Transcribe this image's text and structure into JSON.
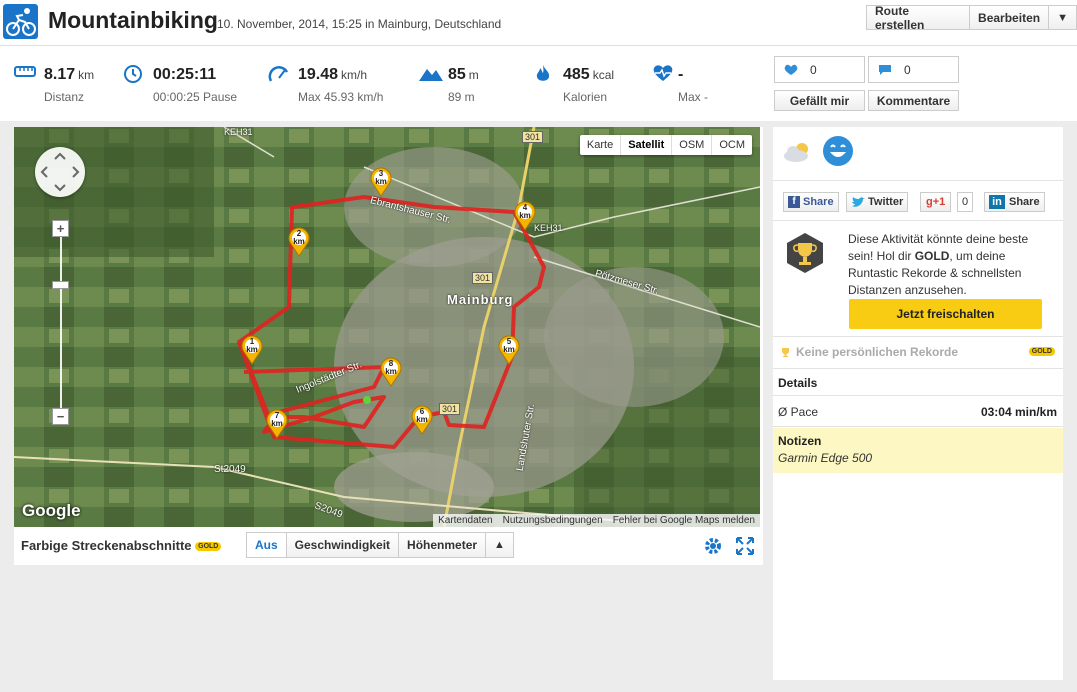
{
  "header": {
    "title": "Mountainbiking",
    "subtitle": "10. November, 2014, 15:25 in Mainburg, Deutschland",
    "sport_icon": "bicycle-icon",
    "buttons": {
      "create_route": "Route erstellen",
      "edit": "Bearbeiten",
      "dropdown": "▼"
    }
  },
  "stats": {
    "distance": {
      "value": "8.17",
      "unit": "km",
      "label": "Distanz",
      "icon": "ruler-icon"
    },
    "duration": {
      "value": "00:25:11",
      "sub": "00:00:25 Pause",
      "icon": "clock-icon"
    },
    "speed": {
      "value": "19.48",
      "unit": "km/h",
      "sub": "Max 45.93 km/h",
      "icon": "speedometer-icon"
    },
    "elevation": {
      "value": "85",
      "unit": "m",
      "sub": "89 m",
      "icon": "mountain-icon"
    },
    "calories": {
      "value": "485",
      "unit": "kcal",
      "label": "Kalorien",
      "icon": "flame-icon"
    },
    "heartrate": {
      "value": "-",
      "sub": "Max -",
      "icon": "heartbeat-icon"
    }
  },
  "social": {
    "likes_count": "0",
    "comments_count": "0",
    "like_label": "Gefällt mir",
    "comment_label": "Kommentare"
  },
  "map": {
    "types": [
      "Karte",
      "Satellit",
      "OSM",
      "OCM"
    ],
    "active_type": "Satellit",
    "footer": [
      "Kartendaten",
      "Nutzungsbedingungen",
      "Fehler bei Google Maps melden"
    ],
    "google_label": "Google",
    "town_label": "Mainburg",
    "road_labels": [
      "301",
      "KEH31",
      "Ebrantshauser Str.",
      "Pötzmeser Str.",
      "Ingolstädter Str.",
      "Landshuter Str.",
      "St2049",
      "S2049"
    ],
    "km_markers": [
      "1",
      "2",
      "3",
      "4",
      "5",
      "6",
      "7",
      "8"
    ],
    "km_unit": "km",
    "zoom_in": "+",
    "zoom_out": "−",
    "route_color": "#e0211f"
  },
  "map_toolbar": {
    "label": "Farbige Streckenabschnitte",
    "gold": "GOLD",
    "segments": [
      "Aus",
      "Geschwindigkeit",
      "Höhenmeter",
      "▲"
    ],
    "active_segment": "Aus"
  },
  "sidebar": {
    "share_buttons": {
      "facebook": "Share",
      "twitter": "Twitter",
      "gplus": "+1",
      "gplus_count": "0",
      "linkedin": "Share"
    },
    "gold_text_1": "Diese Aktivität könnte deine beste sein! Hol dir ",
    "gold_text_bold": "GOLD",
    "gold_text_2": ", um deine Runtastic Rekorde & schnellsten Distanzen anzusehen.",
    "unlock_button": "Jetzt freischalten",
    "records_label": "Keine persönlichen Rekorde",
    "records_badge": "GOLD",
    "details_title": "Details",
    "pace_label": "Ø Pace",
    "pace_value": "03:04 min/km",
    "notes_title": "Notizen",
    "notes_text": "Garmin Edge 500"
  },
  "colors": {
    "brand_blue": "#1a75c9",
    "gold": "#f7cc12",
    "notes_bg": "#fdf8c3"
  }
}
